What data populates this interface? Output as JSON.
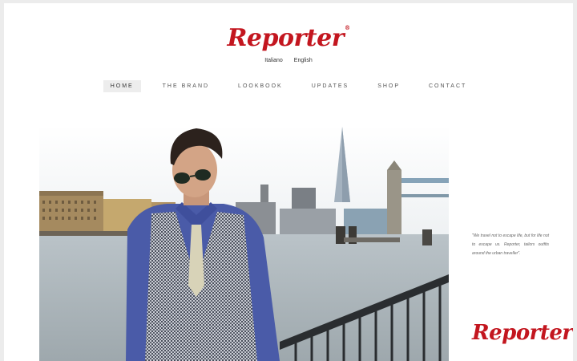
{
  "brand": {
    "logo_text": "Reporter",
    "registered_mark": "®",
    "accent_color": "#c3161f"
  },
  "languages": [
    "Italiano",
    "English"
  ],
  "nav": {
    "items": [
      {
        "label": "HOME",
        "active": true
      },
      {
        "label": "THE BRAND",
        "active": false
      },
      {
        "label": "LOOKBOOK",
        "active": false
      },
      {
        "label": "UPDATES",
        "active": false
      },
      {
        "label": "SHOP",
        "active": false
      },
      {
        "label": "CONTACT",
        "active": false
      }
    ]
  },
  "quote": "\"We travel not to escape life, but for life not to escape us. Reporter, tailors outfits around the urban traveller\".",
  "footer_logo": {
    "text": "Reporter",
    "registered_mark": "®"
  }
}
